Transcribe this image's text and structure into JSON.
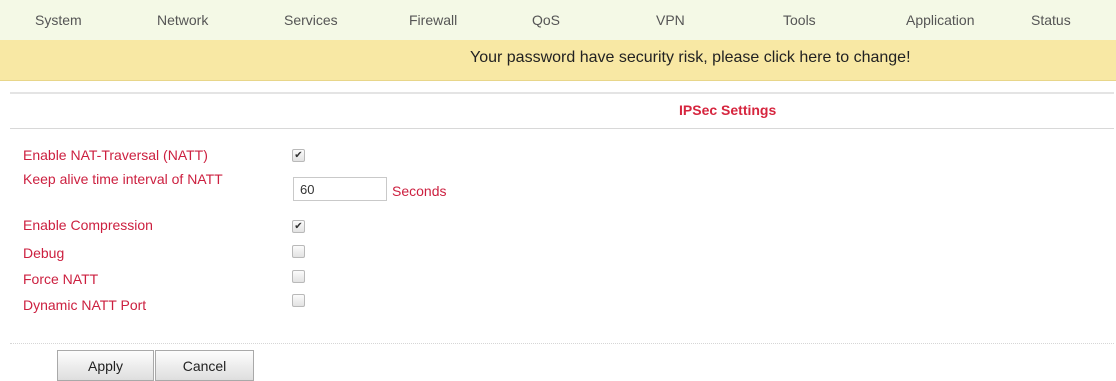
{
  "nav": {
    "items": [
      {
        "label": "System"
      },
      {
        "label": "Network"
      },
      {
        "label": "Services"
      },
      {
        "label": "Firewall"
      },
      {
        "label": "QoS"
      },
      {
        "label": "VPN"
      },
      {
        "label": "Tools"
      },
      {
        "label": "Application"
      },
      {
        "label": "Status"
      }
    ]
  },
  "banner": {
    "text": "Your password have security risk, please click here to change!"
  },
  "section": {
    "title": "IPSec Settings"
  },
  "form": {
    "natt": {
      "label": "Enable NAT-Traversal (NATT)",
      "checked": true
    },
    "keepalive": {
      "label": "Keep alive time interval of NATT",
      "value": "60",
      "unit": "Seconds"
    },
    "compression": {
      "label": "Enable Compression",
      "checked": true
    },
    "debug": {
      "label": "Debug",
      "checked": false
    },
    "force_natt": {
      "label": "Force NATT",
      "checked": false
    },
    "dynamic_natt_port": {
      "label": "Dynamic NATT Port",
      "checked": false
    }
  },
  "buttons": {
    "apply": "Apply",
    "cancel": "Cancel"
  },
  "colors": {
    "nav_bg": "#f4f9e6",
    "banner_bg": "#f8e8a4",
    "label_red": "#cc1f3f",
    "title_red": "#d6253e"
  },
  "icons": {
    "check": "✔"
  }
}
